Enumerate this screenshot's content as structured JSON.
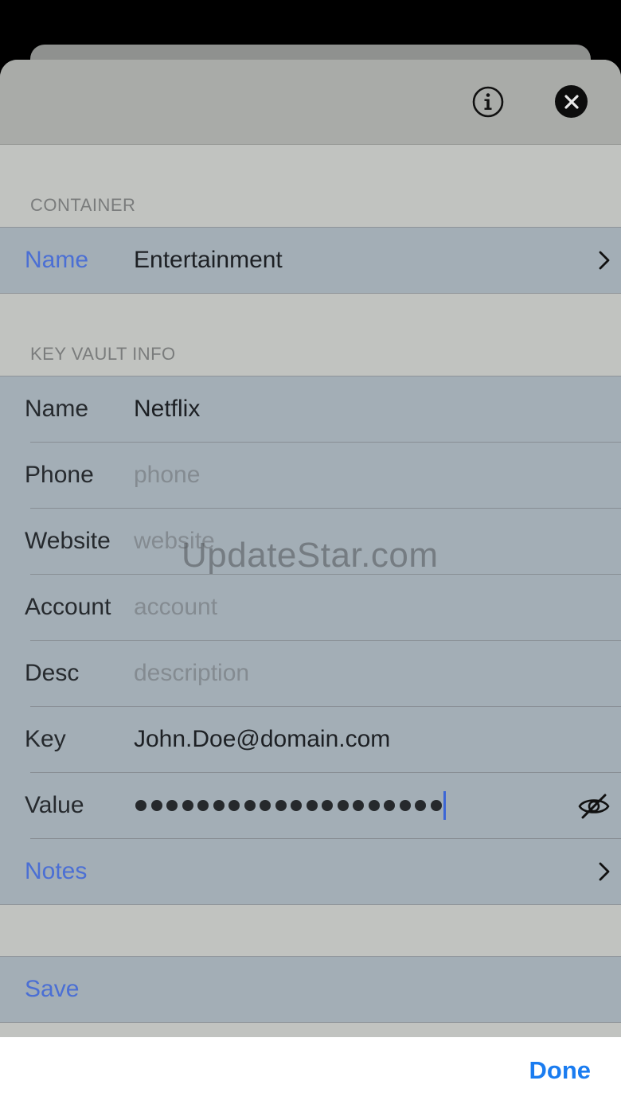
{
  "container_section": {
    "header": "CONTAINER",
    "name_label": "Name",
    "name_value": "Entertainment"
  },
  "key_vault_section": {
    "header": "KEY VAULT INFO",
    "fields": {
      "name": {
        "label": "Name",
        "value": "Netflix"
      },
      "phone": {
        "label": "Phone",
        "placeholder": "phone"
      },
      "website": {
        "label": "Website",
        "placeholder": "website"
      },
      "account": {
        "label": "Account",
        "placeholder": "account"
      },
      "desc": {
        "label": "Desc",
        "placeholder": "description"
      },
      "key": {
        "label": "Key",
        "value": "John.Doe@domain.com"
      },
      "value": {
        "label": "Value",
        "masked_length": 20
      }
    },
    "notes_label": "Notes"
  },
  "save_label": "Save",
  "keyboard_toolbar": {
    "done_label": "Done"
  },
  "watermark": "UpdateStar.com",
  "icons": {
    "info": "info-circle-icon",
    "close": "close-icon",
    "chevron": "chevron-right-icon",
    "visibility": "eye-slash-icon"
  },
  "colors": {
    "link": "#4b6fd4",
    "done": "#1a7cf0",
    "cell_background": "#a3aeb6"
  }
}
